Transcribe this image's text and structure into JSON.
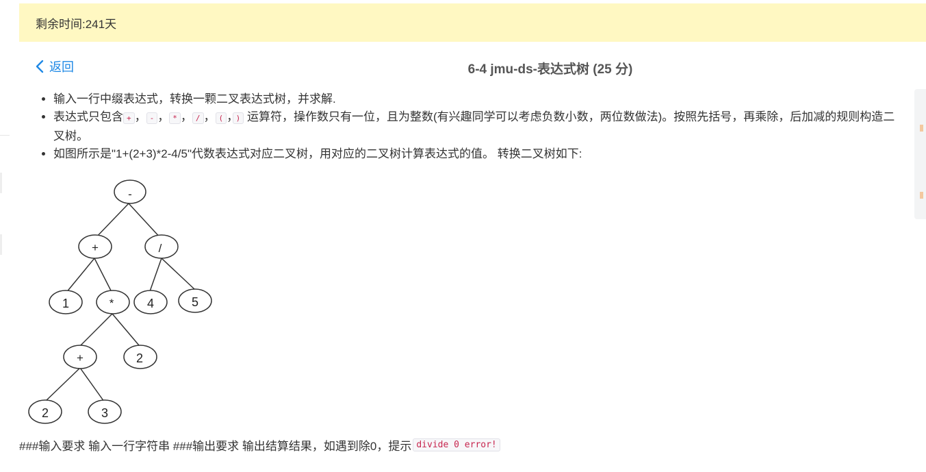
{
  "banner": {
    "text": "剩余时间:241天"
  },
  "header": {
    "back_label": "返回",
    "title": "6-4 jmu-ds-表达式树 (25 分)"
  },
  "problem": {
    "item1": "输入一行中缀表达式，转换一颗二叉表达式树，并求解.",
    "item2_prefix": "表达式只包含",
    "operators": [
      "+",
      "-",
      "*",
      "/",
      "(",
      ")"
    ],
    "sep": "，",
    "item2_suffix": "运算符，操作数只有一位，且为整数(有兴趣同学可以考虑负数小数，两位数做法)。按照先括号，再乘除，后加减的规则构造二叉树。",
    "item3": "如图所示是\"1+(2+3)*2-4/5\"代数表达式对应二叉树，用对应的二叉树计算表达式的值。 转换二叉树如下:"
  },
  "tree": {
    "nodes": [
      {
        "id": "n-root",
        "label": "-"
      },
      {
        "id": "n-plus1",
        "label": "+"
      },
      {
        "id": "n-div",
        "label": "/"
      },
      {
        "id": "n-1",
        "label": "1"
      },
      {
        "id": "n-mul",
        "label": "*"
      },
      {
        "id": "n-4",
        "label": "4"
      },
      {
        "id": "n-5",
        "label": "5"
      },
      {
        "id": "n-plus2",
        "label": "+"
      },
      {
        "id": "n-2a",
        "label": "2"
      },
      {
        "id": "n-2b",
        "label": "2"
      },
      {
        "id": "n-3",
        "label": "3"
      }
    ]
  },
  "requirements": {
    "text": "###输入要求 输入一行字符串 ###输出要求 输出结算结果，如遇到除0，提示",
    "error_code": "divide 0 error!"
  },
  "colors": {
    "banner_bg": "#fff8c2",
    "link": "#1e88e5",
    "code_red": "#c7254e"
  }
}
